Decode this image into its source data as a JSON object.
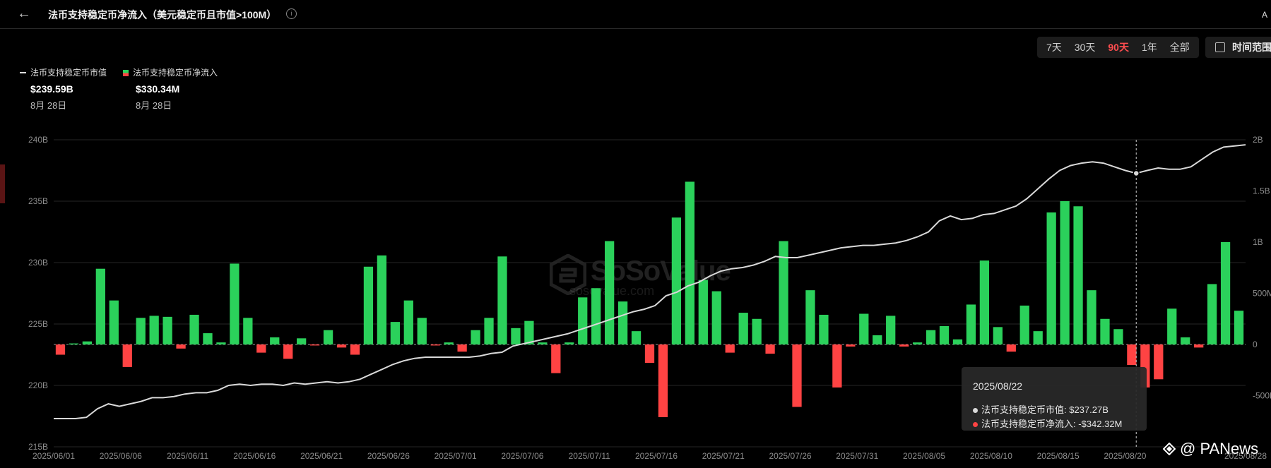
{
  "header": {
    "title": "法币支持稳定币净流入（美元稳定币且市值>100M）",
    "info_glyph": "i",
    "corner_mark": "A"
  },
  "range_buttons": [
    "7天",
    "30天",
    "90天",
    "1年",
    "全部"
  ],
  "active_range": "90天",
  "time_range_label": "时间范围",
  "legend": {
    "market_cap": {
      "label": "法币支持稳定币市值",
      "value": "$239.59B",
      "date": "8月 28日"
    },
    "net_inflow": {
      "label": "法币支持稳定币净流入",
      "value": "$330.34M",
      "date": "8月 28日"
    }
  },
  "tooltip": {
    "date": "2025/08/22",
    "market_cap_text": "法币支持稳定币市值: $237.27B",
    "net_inflow_text": "法币支持稳定币净流入: -$342.32M"
  },
  "watermark": {
    "brand": "SoSoValue",
    "url": "sosovalue.com"
  },
  "credit": "@ PANews",
  "colors": {
    "positive": "#2bd15b",
    "negative": "#ff4343",
    "line": "#d9d9d9",
    "grid": "#262626",
    "accent": "#ff4d4f"
  },
  "chart_data": {
    "type": "bar",
    "title": "法币支持稳定币净流入（美元稳定币且市值>100M）",
    "x_tick_labels": [
      "2025/06/01",
      "2025/06/06",
      "2025/06/11",
      "2025/06/16",
      "2025/06/21",
      "2025/06/26",
      "2025/07/01",
      "2025/07/06",
      "2025/07/11",
      "2025/07/16",
      "2025/07/21",
      "2025/07/26",
      "2025/07/31",
      "2025/08/05",
      "2025/08/10",
      "2025/08/15",
      "2025/08/20",
      "2025/08/28"
    ],
    "y_left_ticks": [
      "240B",
      "235B",
      "230B",
      "225B",
      "220B",
      "215B"
    ],
    "y_left_range": [
      215,
      240
    ],
    "y_right_ticks": [
      "2B",
      "1.5B",
      "1B",
      "500M",
      "0",
      "-500M"
    ],
    "y_right_range": [
      -1,
      2
    ],
    "grid": true,
    "hover_date": "2025/08/22",
    "series": [
      {
        "name": "法币支持稳定币净流入",
        "type": "bar",
        "axis": "right",
        "unit": "B",
        "values": [
          -0.1,
          0.01,
          0.03,
          0.74,
          0.43,
          -0.22,
          0.26,
          0.28,
          0.27,
          -0.04,
          0.29,
          0.11,
          0.02,
          0.79,
          0.26,
          -0.08,
          0.07,
          -0.14,
          0.06,
          -0.01,
          0.14,
          -0.03,
          -0.1,
          0.76,
          0.87,
          0.22,
          0.43,
          0.26,
          -0.01,
          0.02,
          -0.07,
          0.14,
          0.26,
          0.86,
          0.16,
          0.23,
          0.02,
          -0.28,
          0.02,
          0.46,
          0.55,
          1.01,
          0.42,
          0.13,
          -0.18,
          -0.71,
          1.24,
          1.59,
          0.63,
          0.52,
          -0.08,
          0.31,
          0.25,
          -0.09,
          1.01,
          -0.61,
          0.53,
          0.29,
          -0.42,
          -0.02,
          0.3,
          0.09,
          0.28,
          -0.02,
          0.02,
          0.14,
          0.18,
          0.05,
          0.39,
          0.82,
          0.17,
          -0.07,
          0.38,
          0.13,
          1.29,
          1.4,
          1.35,
          0.53,
          0.25,
          0.15,
          -0.2,
          -0.42,
          -0.34,
          0.35,
          0.07,
          -0.03,
          0.59,
          1.0,
          0.33
        ]
      },
      {
        "name": "法币支持稳定币市值",
        "type": "line",
        "axis": "left",
        "unit": "B",
        "values": [
          217.3,
          217.3,
          217.3,
          217.4,
          218.1,
          218.5,
          218.3,
          218.5,
          218.7,
          219.0,
          219.0,
          219.1,
          219.3,
          219.4,
          219.4,
          219.6,
          220.0,
          220.1,
          220.0,
          220.1,
          220.1,
          220.0,
          220.2,
          220.1,
          220.2,
          220.3,
          220.2,
          220.3,
          220.5,
          220.9,
          221.3,
          221.7,
          222.0,
          222.2,
          222.3,
          222.3,
          222.3,
          222.3,
          222.3,
          222.4,
          222.6,
          222.7,
          223.2,
          223.4,
          223.6,
          223.8,
          224.0,
          224.2,
          224.5,
          224.8,
          225.1,
          225.4,
          225.7,
          226.0,
          226.2,
          226.5,
          227.3,
          227.6,
          228.1,
          228.4,
          228.9,
          229.3,
          229.5,
          229.6,
          229.8,
          230.1,
          230.5,
          230.4,
          230.4,
          230.6,
          230.8,
          231.0,
          231.2,
          231.3,
          231.4,
          231.4,
          231.5,
          231.6,
          231.8,
          232.1,
          232.5,
          233.4,
          233.8,
          233.5,
          233.6,
          233.9,
          234.0,
          234.3,
          234.6,
          235.2,
          236.0,
          236.8,
          237.5,
          237.9,
          238.1,
          238.2,
          238.1,
          237.8,
          237.5,
          237.27,
          237.5,
          237.7,
          237.6,
          237.6,
          237.8,
          238.4,
          239.0,
          239.4,
          239.5,
          239.59
        ]
      }
    ]
  }
}
